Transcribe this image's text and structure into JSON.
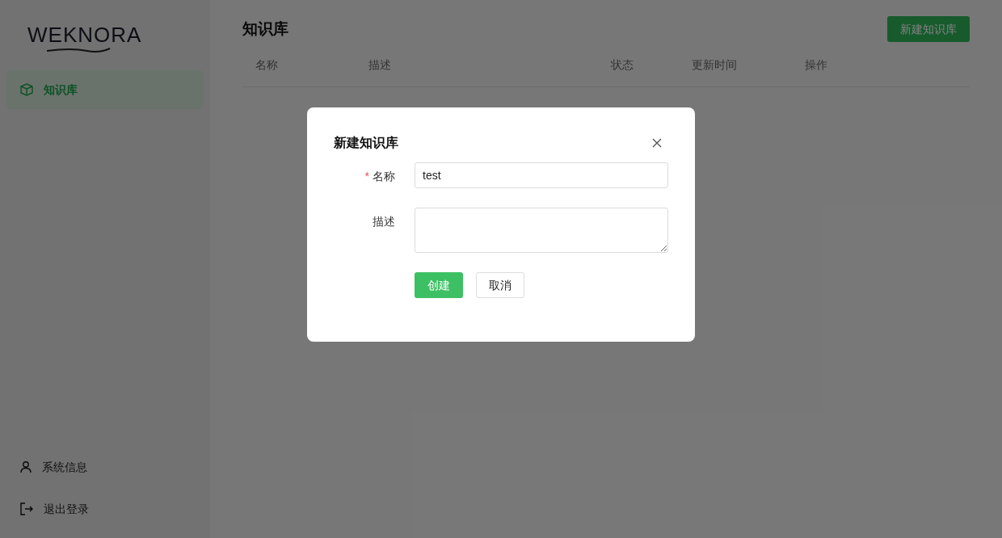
{
  "logo": {
    "text": "WEKNORA"
  },
  "sidebar": {
    "items": [
      {
        "label": "知识库",
        "kind": "cube",
        "selected": true
      }
    ],
    "footer_items": [
      {
        "label": "系统信息",
        "kind": "user"
      },
      {
        "label": "退出登录",
        "kind": "logout"
      }
    ]
  },
  "page": {
    "title": "知识库",
    "action_button": "新建知识库"
  },
  "table": {
    "columns": [
      "名称",
      "描述",
      "状态",
      "更新时间",
      "操作"
    ]
  },
  "dialog": {
    "title": "新建知识库",
    "fields": [
      {
        "label": "名称",
        "required_mark": "*",
        "kind": "input",
        "value": "test"
      },
      {
        "label": "描述",
        "kind": "textarea"
      }
    ],
    "buttons": [
      {
        "label": "创建",
        "kind": "primary"
      },
      {
        "label": "取消",
        "kind": "secondary"
      }
    ]
  }
}
